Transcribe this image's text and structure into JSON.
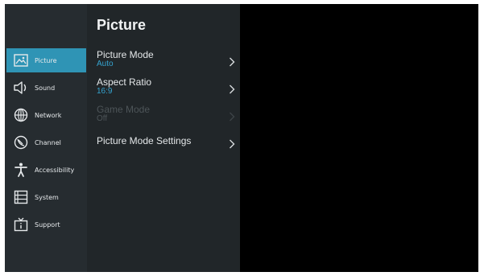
{
  "sidebar": {
    "items": [
      {
        "label": "Picture",
        "icon": "picture-icon",
        "active": true
      },
      {
        "label": "Sound",
        "icon": "speaker-icon"
      },
      {
        "label": "Network",
        "icon": "globe-icon"
      },
      {
        "label": "Channel",
        "icon": "satellite-dish-icon"
      },
      {
        "label": "Accessibility",
        "icon": "accessibility-person-icon"
      },
      {
        "label": "System",
        "icon": "system-list-icon"
      },
      {
        "label": "Support",
        "icon": "tv-support-icon"
      }
    ]
  },
  "main": {
    "title": "Picture",
    "rows": [
      {
        "title": "Picture Mode",
        "value": "Auto",
        "enabled": true
      },
      {
        "title": "Aspect Ratio",
        "value": "16:9",
        "enabled": true
      },
      {
        "title": "Game Mode",
        "value": "Off",
        "enabled": false
      },
      {
        "title": "Picture Mode Settings",
        "value": "",
        "enabled": true
      }
    ]
  },
  "colors": {
    "accent": "#2f94b5",
    "value_text": "#35a3cf",
    "sidebar_bg": "#262c30",
    "panel_bg": "#212629",
    "screen_bg": "#000000",
    "disabled_text": "#4d5458"
  }
}
